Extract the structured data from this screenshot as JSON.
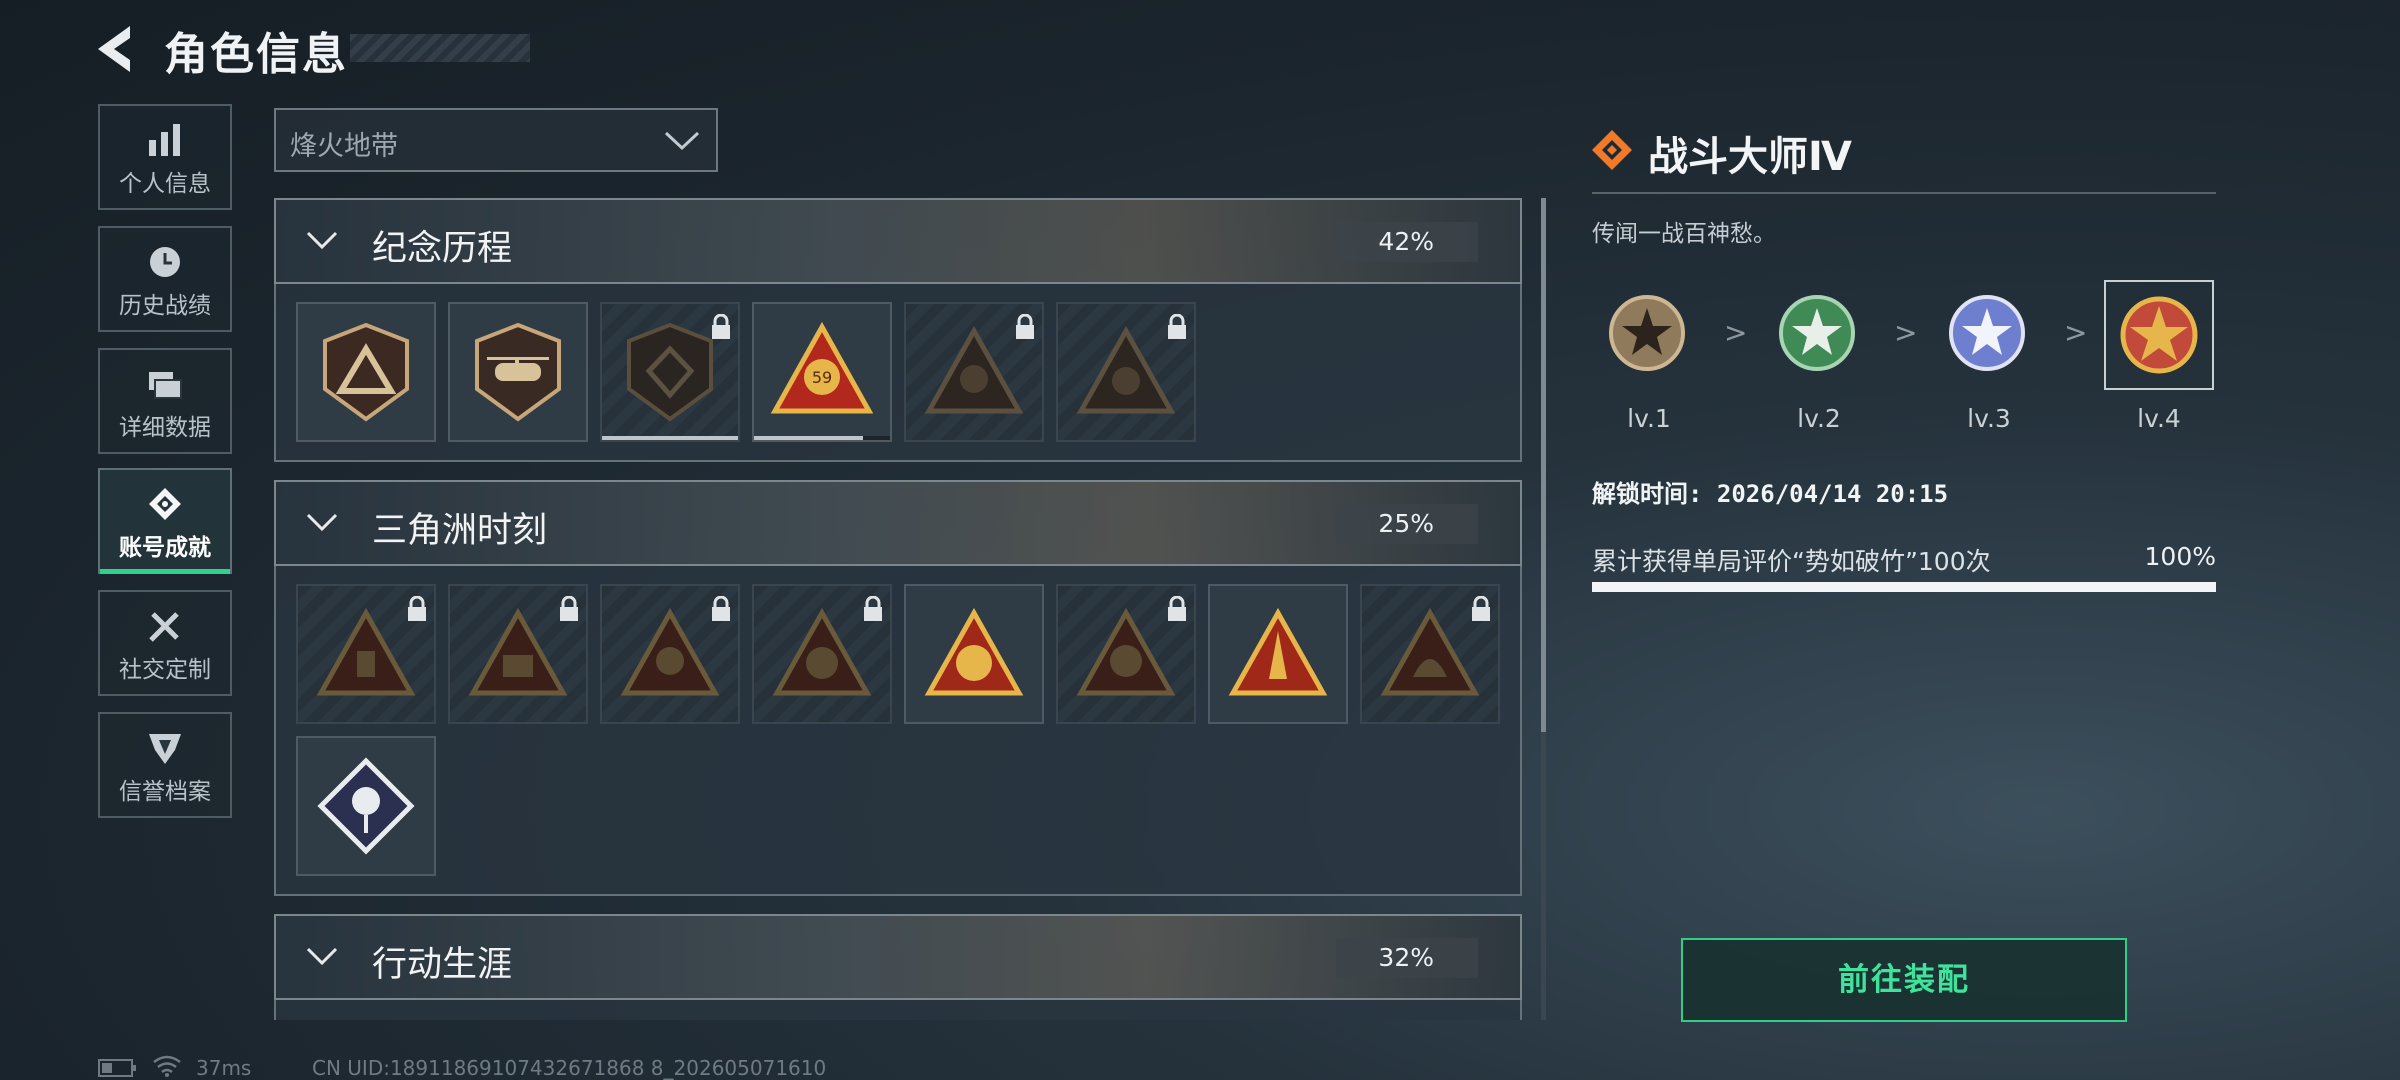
{
  "header": {
    "title": "角色信息"
  },
  "nav": [
    {
      "label": "个人信息",
      "icon": "bar-chart-icon"
    },
    {
      "label": "历史战绩",
      "icon": "clock-icon"
    },
    {
      "label": "详细数据",
      "icon": "folders-icon"
    },
    {
      "label": "账号成就",
      "icon": "achievement-icon",
      "active": true
    },
    {
      "label": "社交定制",
      "icon": "wrench-icon"
    },
    {
      "label": "信誉档案",
      "icon": "shield-icon"
    }
  ],
  "dropdown": {
    "value": "烽火地带"
  },
  "categories": [
    {
      "name": "纪念历程",
      "percent": "42%"
    },
    {
      "name": "三角洲时刻",
      "percent": "25%"
    },
    {
      "name": "行动生涯",
      "percent": "32%"
    }
  ],
  "badges_row1": [
    {
      "locked": false
    },
    {
      "locked": false
    },
    {
      "locked": true,
      "progress": 1.0
    },
    {
      "locked": false,
      "progress": 0.8,
      "label": "59"
    },
    {
      "locked": true
    },
    {
      "locked": true
    }
  ],
  "detail": {
    "title": "战斗大师Ⅳ",
    "description": "传闻一战百神愁。",
    "levels": [
      "lv.1",
      "lv.2",
      "lv.3",
      "lv.4"
    ],
    "level_colors": [
      "#8f7a5c",
      "#3f8a55",
      "#6f7fd0",
      "#c24a3a"
    ],
    "arrow": ">",
    "unlock_time": "解锁时间: 2026/04/14 20:15",
    "task": "累计获得单局评价“势如破竹”100次",
    "task_percent": "100%",
    "task_progress": 1.0,
    "equip_button": "前往装配"
  },
  "status": {
    "ping": "37ms",
    "uid": "CN UID:18911869107432671868 8_202605071610"
  },
  "colors": {
    "accent": "#2fd18c",
    "brand": "#f07a2a"
  }
}
